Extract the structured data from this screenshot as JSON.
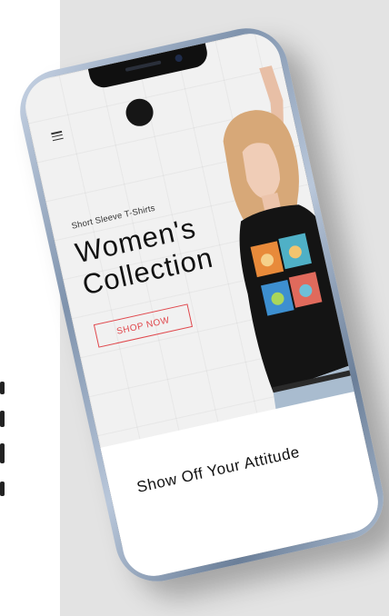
{
  "hero": {
    "subtitle": "Short Sleeve T-Shirts",
    "title_line1": "Women's",
    "title_line2": "Collection",
    "cta_label": "SHOP NOW"
  },
  "section": {
    "tagline": "Show Off Your Attitude"
  },
  "icons": {
    "menu": "hamburger-menu-icon"
  },
  "colors": {
    "accent": "#e0474c",
    "phone_frame": "#8fa2bb",
    "backdrop": "#e3e3e3"
  }
}
